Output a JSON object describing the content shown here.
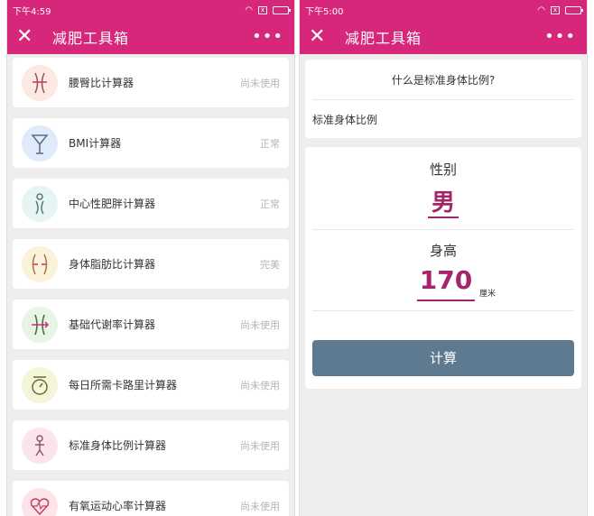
{
  "left_screen": {
    "status_time": "下午4:59",
    "title": "减肥工具箱",
    "close_glyph": "✕",
    "more_glyph": "•••",
    "tools": [
      {
        "name": "腰臀比计算器",
        "status": "尚未使用",
        "icon": "waist-icon",
        "bg": "#fde8e2"
      },
      {
        "name": "BMI计算器",
        "status": "正常",
        "icon": "scale-icon",
        "bg": "#dfeafb"
      },
      {
        "name": "中心性肥胖计算器",
        "status": "正常",
        "icon": "body-icon",
        "bg": "#e6f5f4"
      },
      {
        "name": "身体脂肪比计算器",
        "status": "完美",
        "icon": "fat-icon",
        "bg": "#fcf2dc"
      },
      {
        "name": "基础代谢率计算器",
        "status": "尚未使用",
        "icon": "metabolism-icon",
        "bg": "#e6f5e4"
      },
      {
        "name": "每日所需卡路里计算器",
        "status": "尚未使用",
        "icon": "calorie-icon",
        "bg": "#f5f6d8"
      },
      {
        "name": "标准身体比例计算器",
        "status": "尚未使用",
        "icon": "proportion-icon",
        "bg": "#fce4ec"
      },
      {
        "name": "有氧运动心率计算器",
        "status": "尚未使用",
        "icon": "heart-rate-icon",
        "bg": "#fde4e9"
      }
    ]
  },
  "right_screen": {
    "status_time": "下午5:00",
    "title": "减肥工具箱",
    "close_glyph": "✕",
    "more_glyph": "•••",
    "question": "什么是标准身体比例?",
    "subtitle": "标准身体比例",
    "gender_label": "性别",
    "gender_value": "男",
    "height_label": "身高",
    "height_value": "170",
    "height_unit": "厘米",
    "calc_button": "计算"
  },
  "colors": {
    "brand": "#d6277a",
    "accent_text": "#a3256b",
    "button": "#5e7a90"
  }
}
